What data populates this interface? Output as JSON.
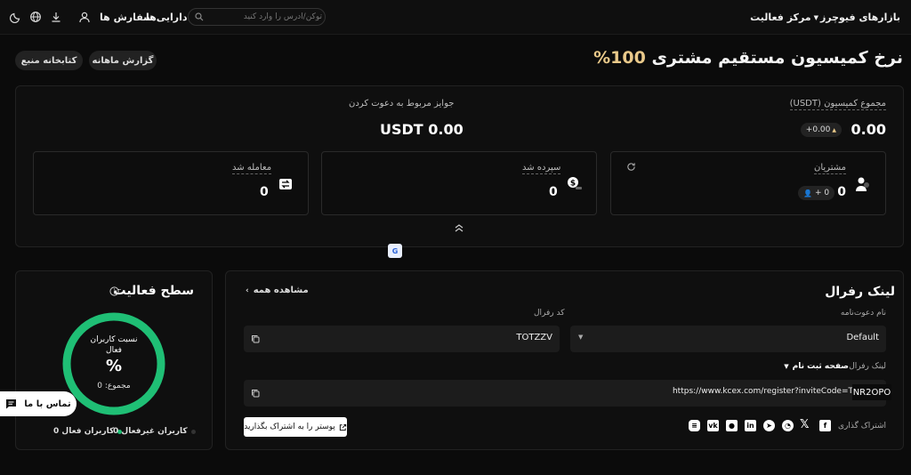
{
  "nav": {
    "futures": "بازارهای فیوچرز",
    "activity": "مرکز فعالیت",
    "orders": "سفارش ها",
    "assets": "دارایی‌ها",
    "search_placeholder": "توکن/آدرس را وارد کنید"
  },
  "header": {
    "title_prefix": "نرخ کمیسیون مستقیم مشتری",
    "title_pct": "100%",
    "monthly_report": "گزارش ماهانه",
    "resource_library": "کتابخانه منبع"
  },
  "summary": {
    "total_commission_label": "مجموع کمیسیون (USDT)",
    "total_commission_value": "0.00",
    "total_commission_change": "+0.00",
    "invite_rewards_label": "جوایز مربوط به دعوت کردن",
    "invite_rewards_value": "USDT 0.00",
    "customers_label": "مشتریان",
    "customers_value": "0",
    "customers_new": "+ 0",
    "deposited_label": "سپرده شد",
    "deposited_value": "0",
    "traded_label": "معامله شد",
    "traded_value": "0"
  },
  "referral": {
    "title": "لینک رفرال",
    "view_all": "مشاهده همه",
    "invite_name_label": "نام دعوت‌نامه",
    "invite_name_value": "Default",
    "ref_code_label": "کد رفرال",
    "ref_code_value": "TOTZZV",
    "ref_link_label": "لینک رفرال",
    "page_select": "صفحه ثبت نام",
    "ref_link_value": "https://www.kcex.com/register?inviteCode=T",
    "ref_link_overlay": "NR2OPO",
    "share_label": "اشتراک گذاری",
    "share_poster": "پوستر را به اشتراک بگذارید"
  },
  "activity": {
    "title": "سطح فعالیت",
    "ratio_label": "نسبت کاربران فعال",
    "ratio_value": "%",
    "total": "مجموع: 0",
    "active_users": "کاربران فعال 0",
    "inactive_users": "کاربران غیرفعال 0"
  },
  "contact": {
    "label": "تماس با ما"
  },
  "colors": {
    "accent_gold": "#e9c98a",
    "gauge_green": "#1fbf75"
  }
}
